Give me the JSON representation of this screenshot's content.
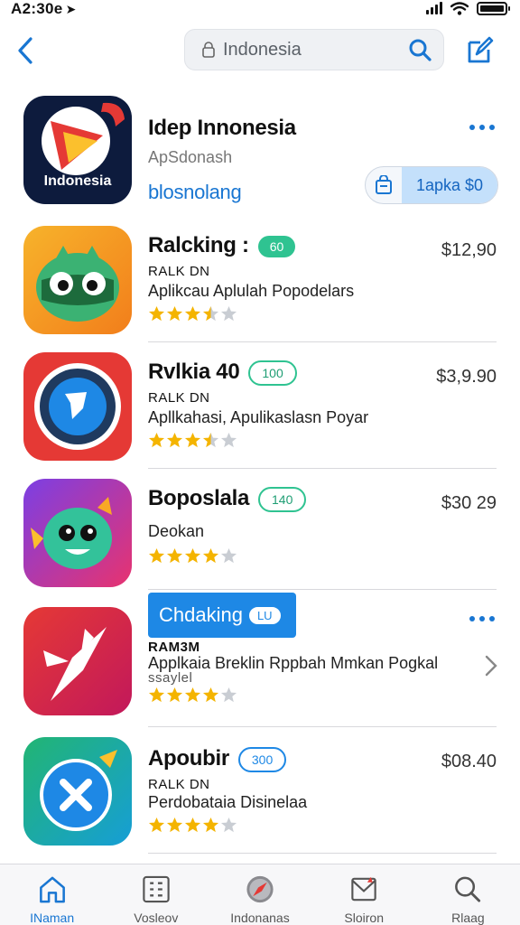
{
  "status": {
    "time": "A2:30e",
    "location_glyph": "➤"
  },
  "nav": {
    "search_placeholder": "Indonesia"
  },
  "featured": {
    "name": "Idep Innonesia",
    "subtitle": "ApSdonash",
    "link": "blosnolang",
    "icon_label": "Indonesia",
    "get_button": "1apka $0"
  },
  "apps": [
    {
      "name": "Ralcking :",
      "badge": "60",
      "sub": "RALK DN",
      "desc": "Aplikcau Aplulah Popodelars",
      "price": "$12,90",
      "rating": 3.5
    },
    {
      "name": "Rvlkia 40",
      "badge": "100",
      "sub": "RALK DN",
      "desc": "Apllkahasi, Apulikaslasn Poyar",
      "price": "$3,9.90",
      "rating": 3.5
    },
    {
      "name": "Boposlala",
      "badge": "140",
      "sub": "",
      "desc": "Deokan",
      "price": "$30 29",
      "rating": 4
    },
    {
      "name": "Chdaking",
      "badge": "LU",
      "sub": "RAM3M",
      "desc": "Applkaia Breklin Rppbah Mmkan Pogkal",
      "desc2": "ssaylel",
      "price": "",
      "rating": 4
    },
    {
      "name": "Apoubir",
      "badge": "300",
      "sub": "RALK DN",
      "desc": "Perdobataia Disinelaa",
      "price": "$08.40",
      "rating": 4
    }
  ],
  "tabs": [
    {
      "label": "INaman",
      "icon": "home-icon"
    },
    {
      "label": "Vosleov",
      "icon": "grid-icon"
    },
    {
      "label": "Indonanas",
      "icon": "compass-icon"
    },
    {
      "label": "Sloiron",
      "icon": "inbox-icon"
    },
    {
      "label": "Rlaag",
      "icon": "search-icon"
    }
  ],
  "colors": {
    "accent": "#1976d2",
    "badge_green": "#2fc391",
    "star": "#f4b400"
  }
}
